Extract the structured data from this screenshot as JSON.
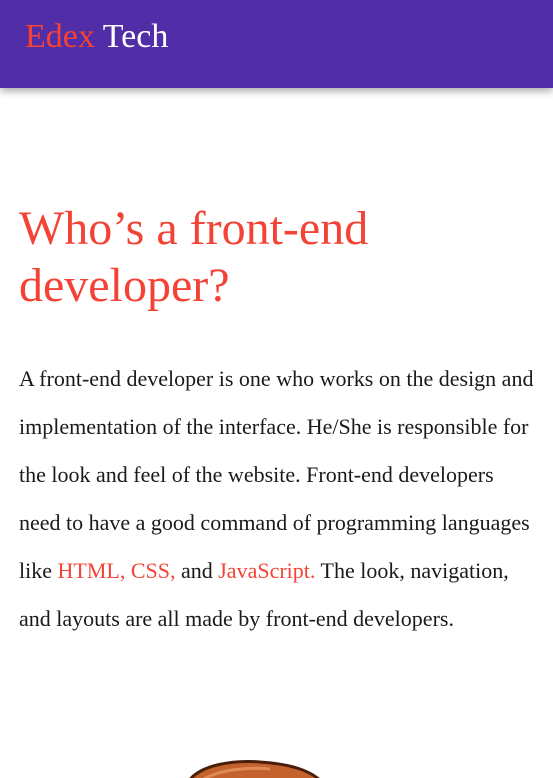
{
  "header": {
    "logo_part1": "Edex",
    "logo_part2": "Tech",
    "background_color": "#512da8",
    "accent_color": "#f44336"
  },
  "article": {
    "title_line1": "Who’s a front-end",
    "title_line2": "developer?",
    "text_1": "A front-end developer is one who works on the design and implementation of the interface. He/She is responsible for the look and feel of the website. Front-end developers need to have a good command of programming languages like ",
    "link_html_css": "HTML, CSS,",
    "text_2": " and ",
    "link_js": "JavaScript.",
    "text_3": " The look, navigation, and layouts are all made by front-end developers."
  },
  "illustration": {
    "icon": "illustration-image",
    "color": "#c4622d"
  }
}
